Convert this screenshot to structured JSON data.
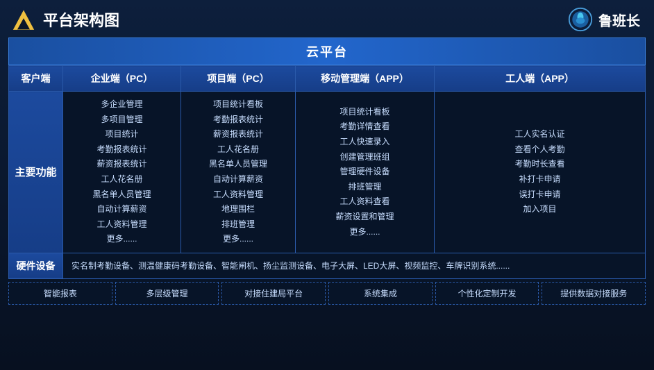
{
  "header": {
    "title": "平台架构图",
    "brand": "鲁班长"
  },
  "cloud": {
    "label": "云平台"
  },
  "columns": {
    "client": "客户端",
    "enterprise_pc": "企业端（PC）",
    "project_pc": "项目端（PC）",
    "mobile_app": "移动管理端（APP）",
    "worker_app": "工人端（APP）"
  },
  "main_function_label": "主要功能",
  "enterprise_items": [
    "多企业管理",
    "多项目管理",
    "项目统计",
    "考勤报表统计",
    "薪资报表统计",
    "工人花名册",
    "黑名单人员管理",
    "自动计算薪资",
    "工人资料管理",
    "更多......"
  ],
  "project_items": [
    "项目统计看板",
    "考勤报表统计",
    "薪资报表统计",
    "工人花名册",
    "黑名单人员管理",
    "自动计算薪资",
    "工人资料管理",
    "地理围栏",
    "排班管理",
    "更多......"
  ],
  "mobile_items": [
    "项目统计看板",
    "考勤详情查看",
    "工人快速录入",
    "创建管理班组",
    "管理硬件设备",
    "排班管理",
    "工人资料查看",
    "薪资设置和管理",
    "更多......"
  ],
  "worker_items": [
    "工人实名认证",
    "查看个人考勤",
    "考勤时长查看",
    "补打卡申请",
    "误打卡申请",
    "加入项目"
  ],
  "hardware": {
    "label": "硬件设备",
    "content": "实名制考勤设备、测温健康码考勤设备、智能闸机、扬尘监测设备、电子大屏、LED大屏、视频监控、车牌识别系统......"
  },
  "features": [
    "智能报表",
    "多层级管理",
    "对接住建局平台",
    "系统集成",
    "个性化定制开发",
    "提供数据对接服务"
  ]
}
